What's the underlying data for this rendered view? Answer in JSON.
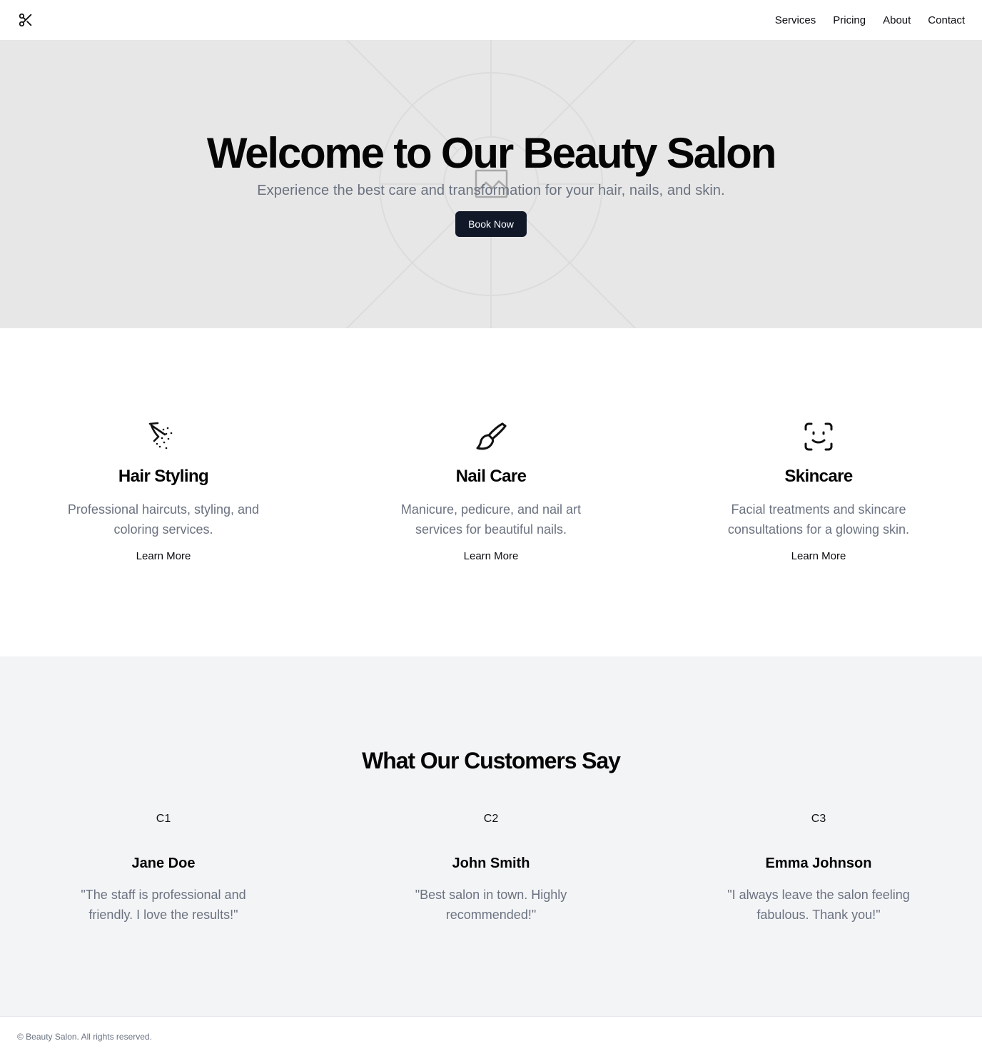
{
  "header": {
    "logo_icon": "scissors-icon",
    "nav": [
      {
        "label": "Services"
      },
      {
        "label": "Pricing"
      },
      {
        "label": "About"
      },
      {
        "label": "Contact"
      }
    ]
  },
  "hero": {
    "title": "Welcome to Our Beauty Salon",
    "subtitle": "Experience the best care and transformation for your hair, nails, and skin.",
    "cta_label": "Book Now",
    "background_icon": "image-placeholder-icon"
  },
  "services": [
    {
      "icon": "hair-spray-icon",
      "title": "Hair Styling",
      "description": "Professional haircuts, styling, and coloring services.",
      "link_label": "Learn More"
    },
    {
      "icon": "paintbrush-icon",
      "title": "Nail Care",
      "description": "Manicure, pedicure, and nail art services for beautiful nails.",
      "link_label": "Learn More"
    },
    {
      "icon": "face-scan-icon",
      "title": "Skincare",
      "description": "Facial treatments and skincare consultations for a glowing skin.",
      "link_label": "Learn More"
    }
  ],
  "testimonials": {
    "title": "What Our Customers Say",
    "items": [
      {
        "avatar": "C1",
        "name": "Jane Doe",
        "quote": "\"The staff is professional and friendly. I love the results!\""
      },
      {
        "avatar": "C2",
        "name": "John Smith",
        "quote": "\"Best salon in town. Highly recommended!\""
      },
      {
        "avatar": "C3",
        "name": "Emma Johnson",
        "quote": "\"I always leave the salon feeling fabulous. Thank you!\""
      }
    ]
  },
  "footer": {
    "copyright": "© Beauty Salon. All rights reserved."
  },
  "colors": {
    "hero_bg": "#e7e7e7",
    "button_bg": "#111827",
    "muted_text": "#6b7280",
    "testimonials_bg": "#f3f4f6"
  }
}
